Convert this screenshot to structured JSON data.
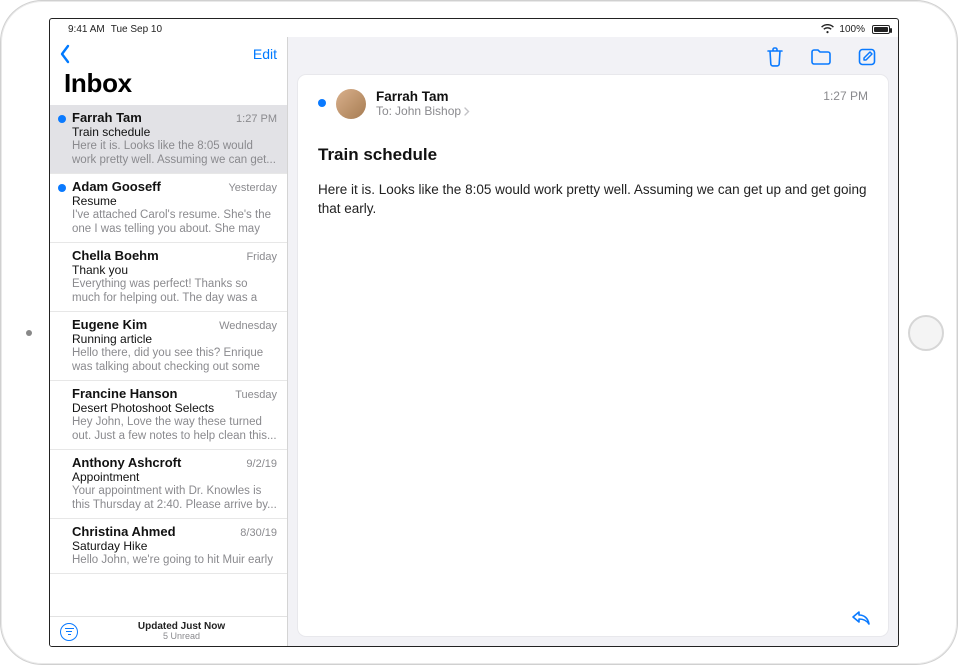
{
  "status": {
    "time": "9:41 AM",
    "date": "Tue Sep 10",
    "battery_pct": "100%"
  },
  "sidebar": {
    "edit_label": "Edit",
    "title": "Inbox",
    "footer_line1": "Updated Just Now",
    "footer_line2": "5 Unread"
  },
  "messages": [
    {
      "sender": "Farrah Tam",
      "time": "1:27 PM",
      "subject": "Train schedule",
      "preview": "Here it is. Looks like the 8:05 would work pretty well. Assuming we can get...",
      "unread": true,
      "selected": true
    },
    {
      "sender": "Adam Gooseff",
      "time": "Yesterday",
      "subject": "Resume",
      "preview": "I've attached Carol's resume. She's the one I was telling you about. She may n...",
      "unread": true,
      "selected": false
    },
    {
      "sender": "Chella Boehm",
      "time": "Friday",
      "subject": "Thank you",
      "preview": "Everything was perfect! Thanks so much for helping out. The day was a great su...",
      "unread": false,
      "selected": false
    },
    {
      "sender": "Eugene Kim",
      "time": "Wednesday",
      "subject": "Running article",
      "preview": "Hello there, did you see this? Enrique was talking about checking out some o...",
      "unread": false,
      "selected": false
    },
    {
      "sender": "Francine Hanson",
      "time": "Tuesday",
      "subject": "Desert Photoshoot Selects",
      "preview": "Hey John, Love the way these turned out. Just a few notes to help clean this...",
      "unread": false,
      "selected": false
    },
    {
      "sender": "Anthony Ashcroft",
      "time": "9/2/19",
      "subject": "Appointment",
      "preview": "Your appointment with Dr. Knowles is this Thursday at 2:40. Please arrive by...",
      "unread": false,
      "selected": false
    },
    {
      "sender": "Christina Ahmed",
      "time": "8/30/19",
      "subject": "Saturday Hike",
      "preview": "Hello John, we're going to hit Muir early",
      "unread": false,
      "selected": false
    }
  ],
  "detail": {
    "from": "Farrah Tam",
    "to_label": "To:",
    "to_name": "John Bishop",
    "time": "1:27 PM",
    "subject": "Train schedule",
    "body": "Here it is. Looks like the 8:05 would work pretty well. Assuming we can get up and get going that early."
  }
}
